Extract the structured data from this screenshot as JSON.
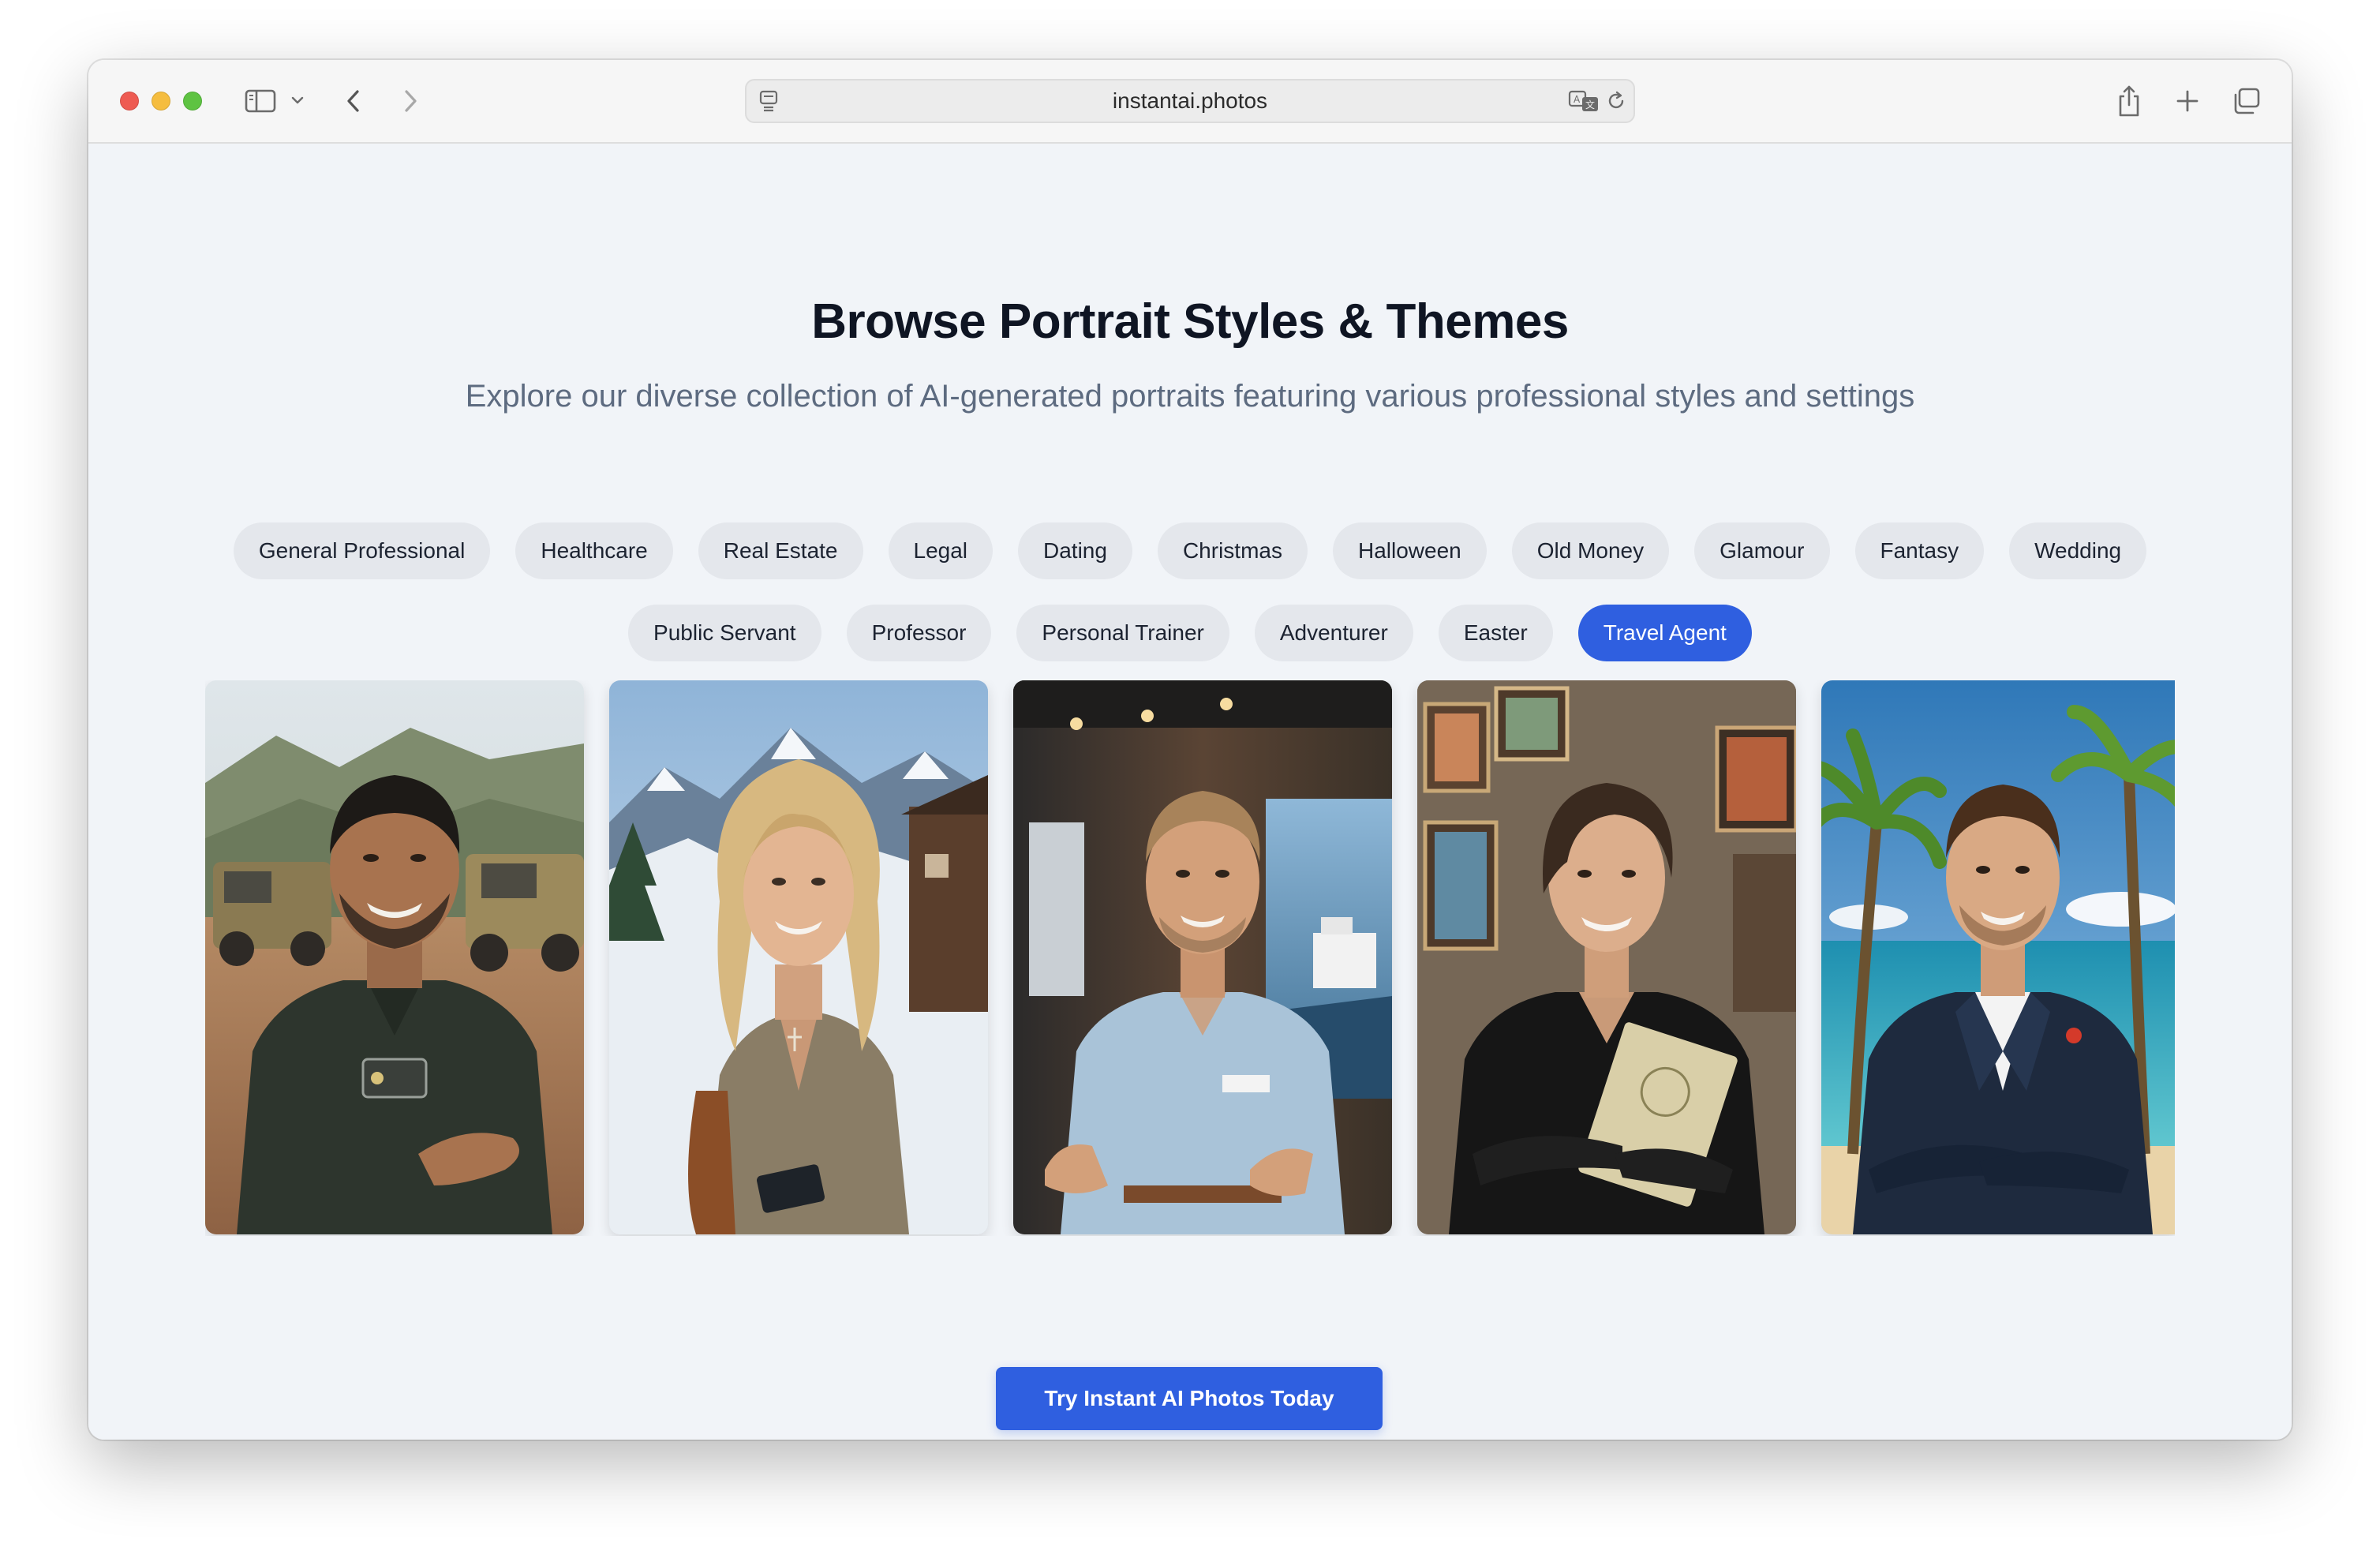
{
  "browser": {
    "url": "instantai.photos"
  },
  "page": {
    "title": "Browse Portrait Styles & Themes",
    "subtitle": "Explore our diverse collection of AI-generated portraits featuring various professional styles and settings"
  },
  "categories": {
    "row1": [
      "General Professional",
      "Healthcare",
      "Real Estate",
      "Legal",
      "Dating",
      "Christmas",
      "Halloween",
      "Old Money",
      "Glamour",
      "Fantasy",
      "Wedding"
    ],
    "row2": [
      "Public Servant",
      "Professor",
      "Personal Trainer",
      "Adventurer",
      "Easter",
      "Travel Agent"
    ],
    "selected": "Travel Agent"
  },
  "gallery": {
    "photos": [
      {
        "subject": "man-safari-vehicles"
      },
      {
        "subject": "woman-mountain-chalet"
      },
      {
        "subject": "man-cruise-office"
      },
      {
        "subject": "woman-framed-pictures"
      },
      {
        "subject": "man-beach-palms"
      }
    ]
  },
  "cta": {
    "label": "Try Instant AI Photos Today"
  },
  "colors": {
    "accent": "#2f5fe0",
    "page_background": "#f1f4f8",
    "chip_background": "#e4e7ec"
  }
}
